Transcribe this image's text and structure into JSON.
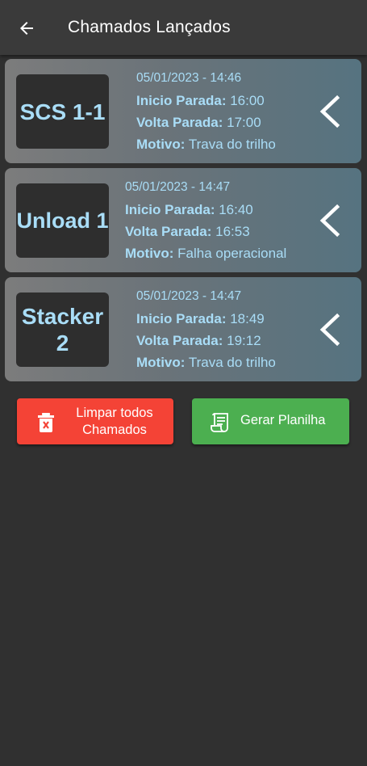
{
  "appbar": {
    "title": "Chamados Lançados",
    "back_icon": "arrow-left-icon"
  },
  "cards": [
    {
      "machine": "SCS 1-1",
      "datetime": "05/01/2023 - 14:46",
      "start_label": "Inicio Parada:",
      "start_value": "16:00",
      "end_label": "Volta Parada:",
      "end_value": "17:00",
      "reason_label": "Motivo:",
      "reason_value": "Trava do trilho"
    },
    {
      "machine": "Unload 1",
      "datetime": "05/01/2023 - 14:47",
      "start_label": "Inicio Parada:",
      "start_value": "16:40",
      "end_label": "Volta Parada:",
      "end_value": "16:53",
      "reason_label": "Motivo:",
      "reason_value": "Falha operacional"
    },
    {
      "machine_line1": "Stacker",
      "machine_line2": "2",
      "datetime": "05/01/2023 - 14:47",
      "start_label": "Inicio Parada:",
      "start_value": "18:49",
      "end_label": "Volta Parada:",
      "end_value": "19:12",
      "reason_label": "Motivo:",
      "reason_value": "Trava do trilho"
    }
  ],
  "buttons": {
    "clear_line1": "Limpar todos",
    "clear_line2": "Chamados",
    "clear_icon": "trash-icon",
    "sheet_label": "Gerar Planilha",
    "sheet_icon": "receipt-icon"
  },
  "colors": {
    "background": "#303030",
    "appbar": "#3a3a3a",
    "accent_text": "#a9ddf7",
    "clear_button": "#f44336",
    "sheet_button": "#4caf50"
  }
}
